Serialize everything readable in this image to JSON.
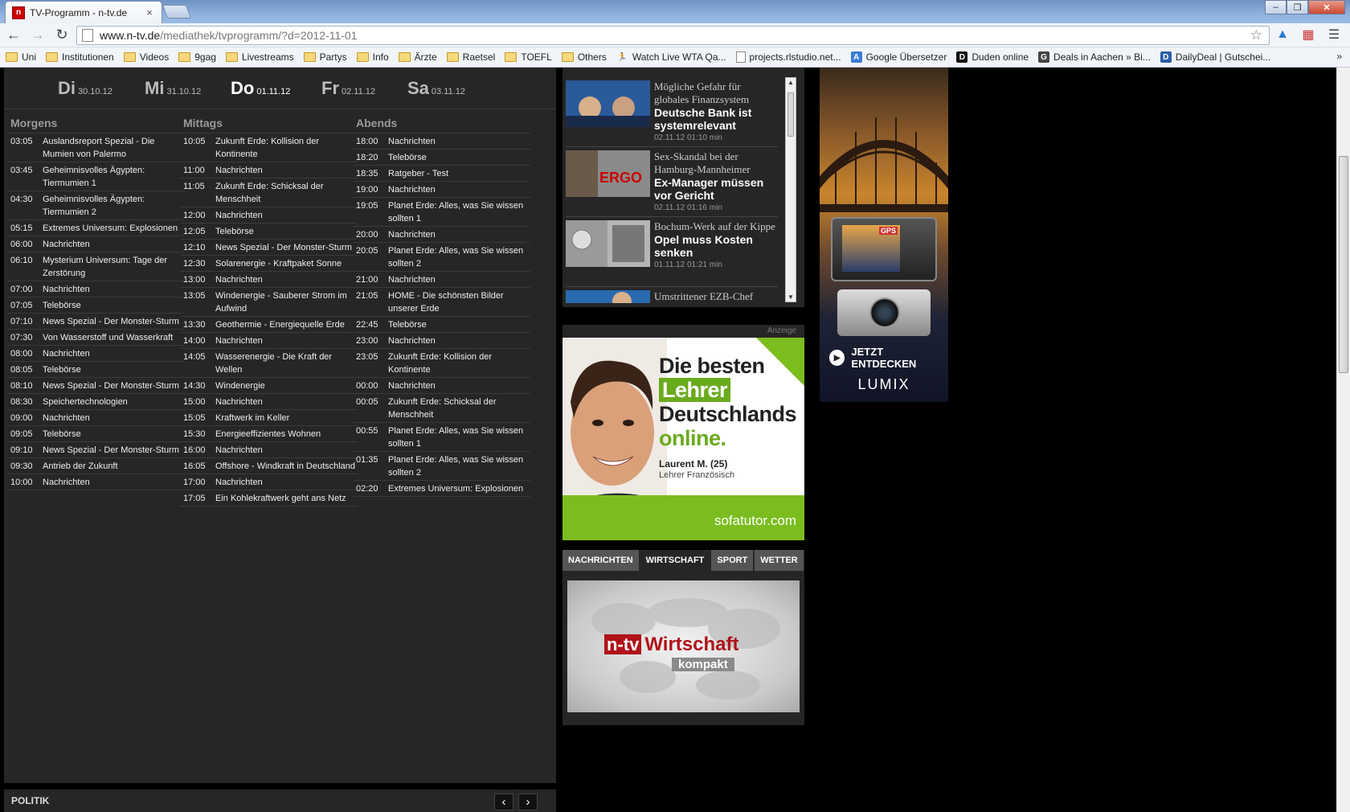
{
  "browser": {
    "tab_title": "TV-Programm - n-tv.de",
    "tab_close": "×",
    "favicon_letter": "n",
    "url_host": "www.n-tv.de",
    "url_path": "/mediathek/tvprogramm/?d=2012-11-01",
    "bookmarks": [
      {
        "label": "Uni",
        "icon": "folder"
      },
      {
        "label": "Institutionen",
        "icon": "folder"
      },
      {
        "label": "Videos",
        "icon": "folder"
      },
      {
        "label": "9gag",
        "icon": "folder"
      },
      {
        "label": "Livestreams",
        "icon": "folder"
      },
      {
        "label": "Partys",
        "icon": "folder"
      },
      {
        "label": "Info",
        "icon": "folder"
      },
      {
        "label": "Ärzte",
        "icon": "folder"
      },
      {
        "label": "Raetsel",
        "icon": "folder"
      },
      {
        "label": "TOEFL",
        "icon": "folder"
      },
      {
        "label": "Others",
        "icon": "folder"
      },
      {
        "label": "Watch Live WTA Qa...",
        "icon": "runner"
      },
      {
        "label": "projects.rlstudio.net...",
        "icon": "page"
      },
      {
        "label": "Google Übersetzer",
        "icon": "translate"
      },
      {
        "label": "Duden online",
        "icon": "duden"
      },
      {
        "label": "Deals in Aachen » Bi...",
        "icon": "groupon"
      },
      {
        "label": "DailyDeal | Gutschei...",
        "icon": "dailydeal"
      }
    ],
    "bookmarks_more": "»"
  },
  "schedule": {
    "days": [
      {
        "name": "Di",
        "date": "30.10.12",
        "active": false
      },
      {
        "name": "Mi",
        "date": "31.10.12",
        "active": false
      },
      {
        "name": "Do",
        "date": "01.11.12",
        "active": true
      },
      {
        "name": "Fr",
        "date": "02.11.12",
        "active": false
      },
      {
        "name": "Sa",
        "date": "03.11.12",
        "active": false
      }
    ],
    "columns": [
      {
        "title": "Morgens",
        "items": [
          {
            "time": "03:05",
            "title": "Auslandsreport Spezial - Die Mumien von Palermo"
          },
          {
            "time": "03:45",
            "title": "Geheimnisvolles Ägypten: Tiermumien 1"
          },
          {
            "time": "04:30",
            "title": "Geheimnisvolles Ägypten: Tiermumien 2"
          },
          {
            "time": "05:15",
            "title": "Extremes Universum: Explosionen"
          },
          {
            "time": "06:00",
            "title": "Nachrichten"
          },
          {
            "time": "06:10",
            "title": "Mysterium Universum: Tage der Zerstörung"
          },
          {
            "time": "07:00",
            "title": "Nachrichten"
          },
          {
            "time": "07:05",
            "title": "Telebörse"
          },
          {
            "time": "07:10",
            "title": "News Spezial - Der Monster-Sturm"
          },
          {
            "time": "07:30",
            "title": "Von Wasserstoff und Wasserkraft"
          },
          {
            "time": "08:00",
            "title": "Nachrichten"
          },
          {
            "time": "08:05",
            "title": "Telebörse"
          },
          {
            "time": "08:10",
            "title": "News Spezial - Der Monster-Sturm"
          },
          {
            "time": "08:30",
            "title": "Speichertechnologien"
          },
          {
            "time": "09:00",
            "title": "Nachrichten"
          },
          {
            "time": "09:05",
            "title": "Telebörse"
          },
          {
            "time": "09:10",
            "title": "News Spezial - Der Monster-Sturm"
          },
          {
            "time": "09:30",
            "title": "Antrieb der Zukunft"
          },
          {
            "time": "10:00",
            "title": "Nachrichten"
          }
        ]
      },
      {
        "title": "Mittags",
        "items": [
          {
            "time": "10:05",
            "title": "Zukunft Erde: Kollision der Kontinente"
          },
          {
            "time": "11:00",
            "title": "Nachrichten"
          },
          {
            "time": "11:05",
            "title": "Zukunft Erde: Schicksal der Menschheit"
          },
          {
            "time": "12:00",
            "title": "Nachrichten"
          },
          {
            "time": "12:05",
            "title": "Telebörse"
          },
          {
            "time": "12:10",
            "title": "News Spezial - Der Monster-Sturm"
          },
          {
            "time": "12:30",
            "title": "Solarenergie - Kraftpaket Sonne"
          },
          {
            "time": "13:00",
            "title": "Nachrichten"
          },
          {
            "time": "13:05",
            "title": "Windenergie - Sauberer Strom im Aufwind"
          },
          {
            "time": "13:30",
            "title": "Geothermie - Energiequelle Erde"
          },
          {
            "time": "14:00",
            "title": "Nachrichten"
          },
          {
            "time": "14:05",
            "title": "Wasserenergie - Die Kraft der Wellen"
          },
          {
            "time": "14:30",
            "title": "Windenergie"
          },
          {
            "time": "15:00",
            "title": "Nachrichten"
          },
          {
            "time": "15:05",
            "title": "Kraftwerk im Keller"
          },
          {
            "time": "15:30",
            "title": "Energieeffizientes Wohnen"
          },
          {
            "time": "16:00",
            "title": "Nachrichten"
          },
          {
            "time": "16:05",
            "title": "Offshore - Windkraft in Deutschland"
          },
          {
            "time": "17:00",
            "title": "Nachrichten"
          },
          {
            "time": "17:05",
            "title": "Ein Kohlekraftwerk geht ans Netz"
          }
        ]
      },
      {
        "title": "Abends",
        "items": [
          {
            "time": "18:00",
            "title": "Nachrichten"
          },
          {
            "time": "18:20",
            "title": "Telebörse"
          },
          {
            "time": "18:35",
            "title": "Ratgeber - Test"
          },
          {
            "time": "19:00",
            "title": "Nachrichten"
          },
          {
            "time": "19:05",
            "title": "Planet Erde: Alles, was Sie wissen sollten 1"
          },
          {
            "time": "20:00",
            "title": "Nachrichten"
          },
          {
            "time": "20:05",
            "title": "Planet Erde: Alles, was Sie wissen sollten 2"
          },
          {
            "time": "21:00",
            "title": "Nachrichten"
          },
          {
            "time": "21:05",
            "title": "HOME - Die schönsten Bilder unserer Erde"
          },
          {
            "time": "22:45",
            "title": "Telebörse"
          },
          {
            "time": "23:00",
            "title": "Nachrichten"
          },
          {
            "time": "23:05",
            "title": "Zukunft Erde: Kollision der Kontinente"
          },
          {
            "time": "00:00",
            "title": "Nachrichten"
          },
          {
            "time": "00:05",
            "title": "Zukunft Erde: Schicksal der Menschheit"
          },
          {
            "time": "00:55",
            "title": "Planet Erde: Alles, was Sie wissen sollten 1"
          },
          {
            "time": "01:35",
            "title": "Planet Erde: Alles, was Sie wissen sollten 2"
          },
          {
            "time": "02:20",
            "title": "Extremes Universum: Explosionen"
          }
        ]
      }
    ],
    "footer_label": "POLITIK",
    "prev": "‹",
    "next": "›"
  },
  "news": [
    {
      "kicker": "Mögliche Gefahr für globales Finanzsystem",
      "headline": "Deutsche Bank ist systemrelevant",
      "meta": "02.11.12 01:10 min",
      "thumb": "thumb-blue"
    },
    {
      "kicker": "Sex-Skandal bei der Hamburg-Mannheimer",
      "headline": "Ex-Manager müssen vor Gericht",
      "meta": "02.11.12 01:16 min",
      "thumb": "thumb-ergo"
    },
    {
      "kicker": "Bochum-Werk auf der Kippe",
      "headline": "Opel muss Kosten senken",
      "meta": "01.11.12 01:21 min",
      "thumb": "thumb-opel"
    },
    {
      "kicker": "Umstrittener EZB-Chef",
      "headline": "",
      "meta": "",
      "thumb": "thumb-ezb"
    }
  ],
  "ad_sofatutor": {
    "label": "Anzeige",
    "line1": "Die besten",
    "line2": "Lehrer",
    "line3": "Deutschlands",
    "line4": "online.",
    "person": "Laurent M. (25)",
    "role": "Lehrer Französisch",
    "brand": "sofatutor.com"
  },
  "video_tabs": [
    "NACHRICHTEN",
    "WIRTSCHAFT",
    "SPORT",
    "WETTER"
  ],
  "video_active": 1,
  "video": {
    "logo_ntv": "n-tv",
    "logo_title": "Wirtschaft",
    "logo_sub": "kompakt"
  },
  "ad_lumix": {
    "gps": "GPS",
    "cta": "JETZT ENTDECKEN",
    "brand": "LUMIX"
  }
}
